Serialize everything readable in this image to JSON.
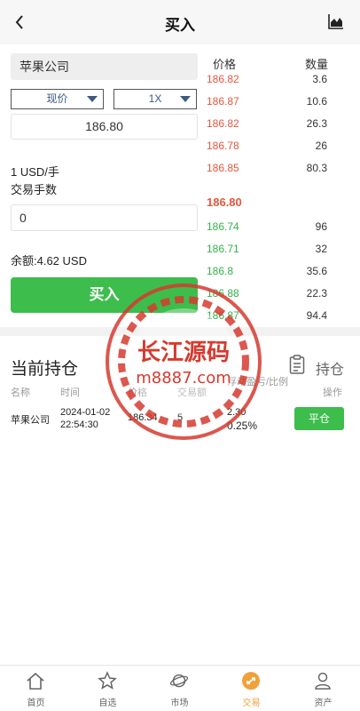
{
  "header": {
    "title": "买入",
    "back_icon": "chevron-left-icon",
    "chart_icon": "chart-area-icon"
  },
  "order": {
    "symbol": "苹果公司",
    "order_type": "现价",
    "leverage": "1X",
    "price": "186.80",
    "unit": "1 USD/手",
    "fee_label": "交易手数",
    "quantity": "0",
    "balance": "余额:4.62 USD",
    "buy_label": "买入",
    "buy_color": "#3dbd4c"
  },
  "book": {
    "price_header": "价格",
    "qty_header": "数量",
    "asks": [
      {
        "price": "186.82",
        "qty": "3.6"
      },
      {
        "price": "186.87",
        "qty": "10.6"
      },
      {
        "price": "186.82",
        "qty": "26.3"
      },
      {
        "price": "186.78",
        "qty": "26"
      },
      {
        "price": "186.85",
        "qty": "80.3"
      }
    ],
    "last_price": "186.80",
    "bids": [
      {
        "price": "186.74",
        "qty": "96"
      },
      {
        "price": "186.71",
        "qty": "32"
      },
      {
        "price": "186.8",
        "qty": "35.6"
      },
      {
        "price": "186.88",
        "qty": "22.3"
      },
      {
        "price": "186.87",
        "qty": "94.4"
      }
    ],
    "ask_color": "#e7553f",
    "bid_color": "#34b04a"
  },
  "positions": {
    "title": "当前持仓",
    "link_label": "持仓",
    "link_icon": "clipboard-icon",
    "columns": {
      "name": "名称",
      "time": "时间",
      "price": "价格",
      "amount": "交易额",
      "pnl": "浮动盈亏/比例",
      "action": "操作"
    },
    "rows": [
      {
        "name": "苹果公司",
        "date": "2024-01-02",
        "time": "22:54:30",
        "price": "186.34",
        "amount": "5",
        "pnl": "2.30",
        "pnl_ratio": "0.25%",
        "action": "平仓"
      }
    ]
  },
  "watermark": {
    "line1": "长江源码",
    "line2": "m8887.com"
  },
  "tabs": [
    {
      "label": "首页",
      "icon": "home-icon"
    },
    {
      "label": "自选",
      "icon": "star-icon"
    },
    {
      "label": "市场",
      "icon": "planet-icon"
    },
    {
      "label": "交易",
      "icon": "trade-icon",
      "active": true
    },
    {
      "label": "资产",
      "icon": "user-icon"
    }
  ],
  "active_color": "#f0a13a"
}
